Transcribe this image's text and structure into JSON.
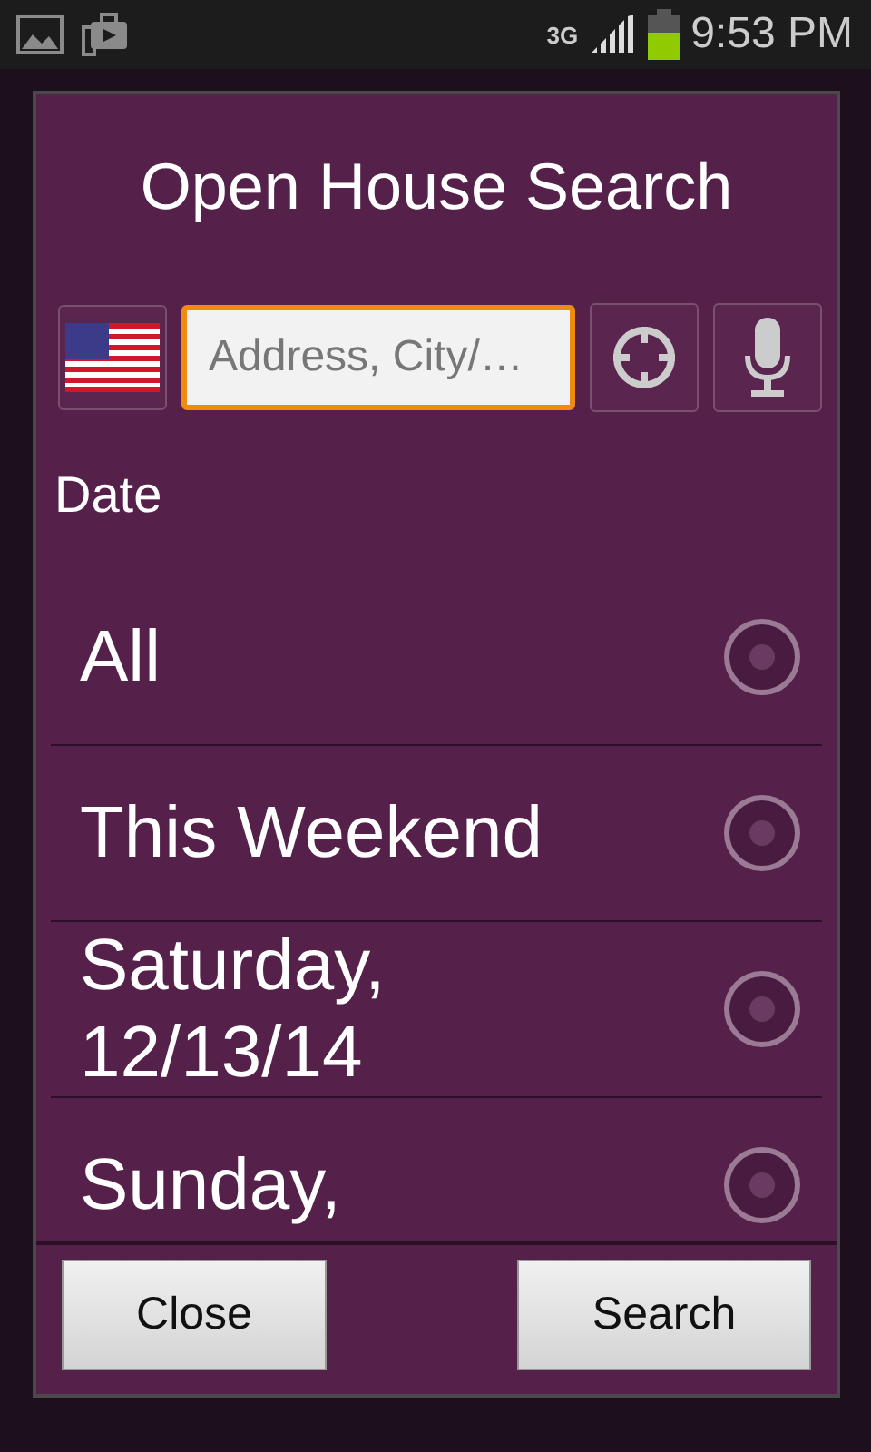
{
  "status_bar": {
    "network": "3G",
    "time": "9:53 PM"
  },
  "dialog": {
    "title": "Open House Search",
    "search": {
      "placeholder": "Address, City/…"
    },
    "section_label": "Date",
    "options": [
      {
        "label": "All",
        "selected": false
      },
      {
        "label": "This Weekend",
        "selected": false
      },
      {
        "label": "Saturday, 12/13/14",
        "selected": false
      },
      {
        "label": "Sunday,",
        "selected": false
      }
    ],
    "buttons": [
      "Close",
      "Search"
    ]
  }
}
